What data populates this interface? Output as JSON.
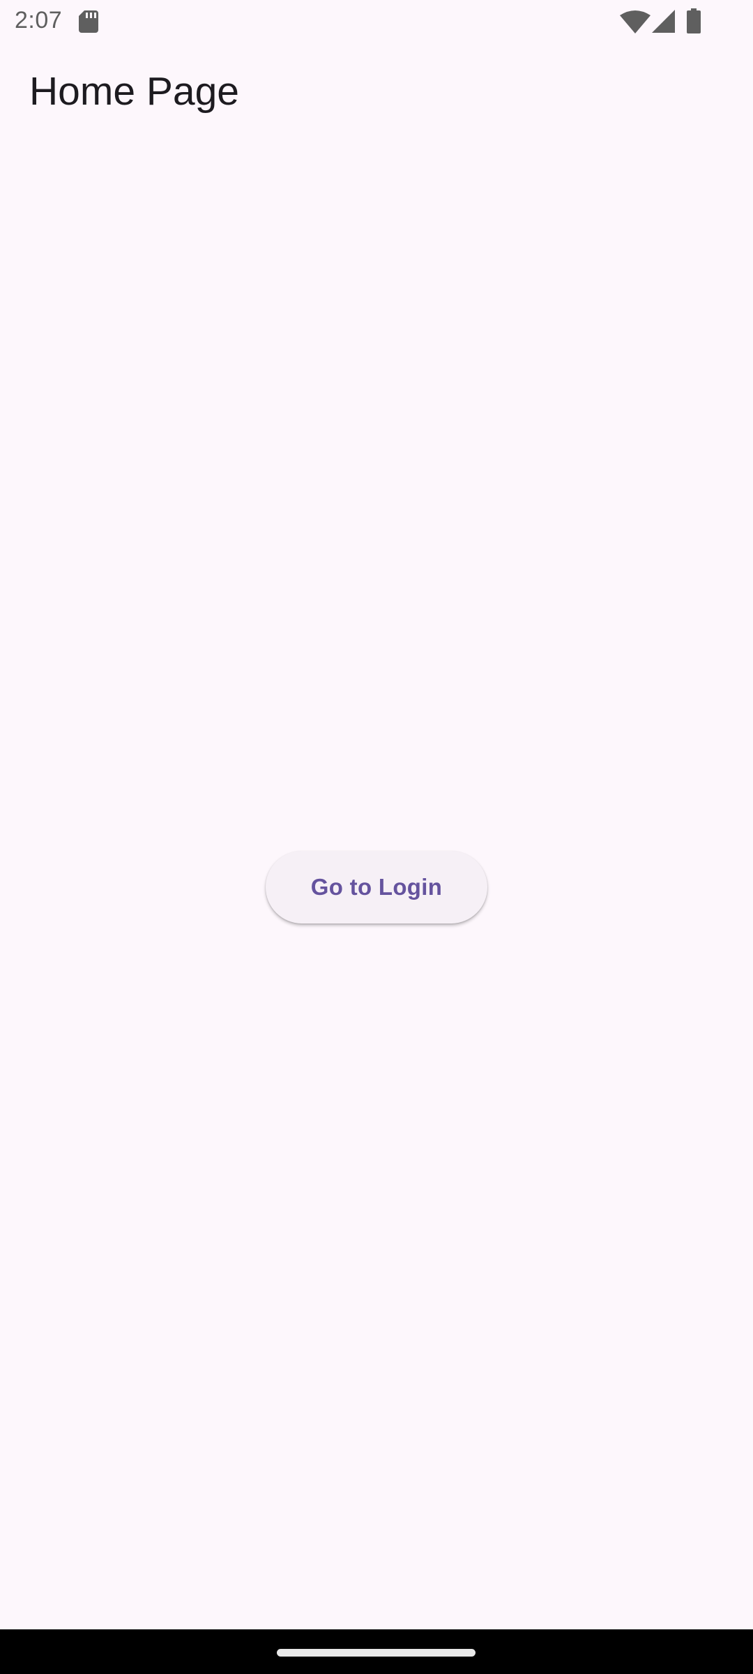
{
  "status_bar": {
    "time": "2:07",
    "icons": [
      "sd-card-icon",
      "wifi-icon",
      "cellular-signal-icon",
      "battery-icon"
    ]
  },
  "app_bar": {
    "title": "Home Page"
  },
  "main": {
    "login_button_label": "Go to Login"
  },
  "colors": {
    "background": "#fdf7fc",
    "button_background": "#f6f0f6",
    "button_text": "#65539e",
    "title_text": "#1d1b20",
    "status_icons": "#5f5f5f",
    "nav_bar": "#000000"
  }
}
